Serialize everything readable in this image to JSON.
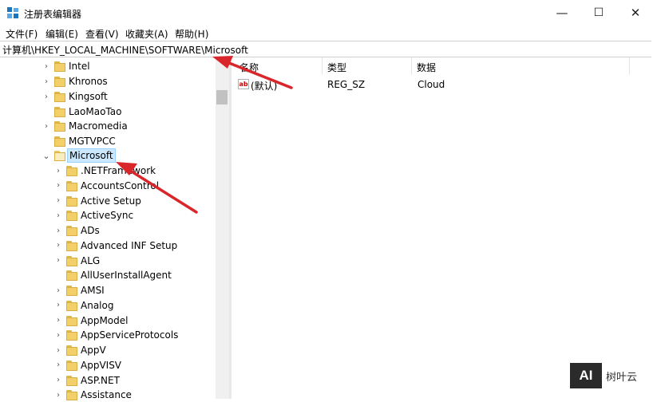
{
  "window": {
    "title": "注册表编辑器",
    "minimize_glyph": "—",
    "maximize_glyph": "☐",
    "close_glyph": "✕"
  },
  "menu": [
    "文件(F)",
    "编辑(E)",
    "查看(V)",
    "收藏夹(A)",
    "帮助(H)"
  ],
  "address": "计算机\\HKEY_LOCAL_MACHINE\\SOFTWARE\\Microsoft",
  "tree": {
    "top_items": [
      "Intel",
      "Khronos",
      "Kingsoft",
      "LaoMaoTao",
      "Macromedia",
      "MGTVPCC"
    ],
    "selected": "Microsoft",
    "children": [
      ".NETFramework",
      "AccountsControl",
      "Active Setup",
      "ActiveSync",
      "ADs",
      "Advanced INF Setup",
      "ALG",
      "AllUserInstallAgent",
      "AMSI",
      "Analog",
      "AppModel",
      "AppServiceProtocols",
      "AppV",
      "AppVISV",
      "ASP.NET",
      "Assistance"
    ]
  },
  "values": {
    "headers": [
      "名称",
      "类型",
      "数据"
    ],
    "rows": [
      {
        "name": "(默认)",
        "type": "REG_SZ",
        "data": "Cloud",
        "icon": "string-value-icon"
      }
    ]
  },
  "watermark": {
    "logo": "AI",
    "text": "树叶云"
  },
  "colors": {
    "selection": "#cce8ff",
    "folder": "#f3cf6a",
    "arrow": "#d9262b"
  }
}
